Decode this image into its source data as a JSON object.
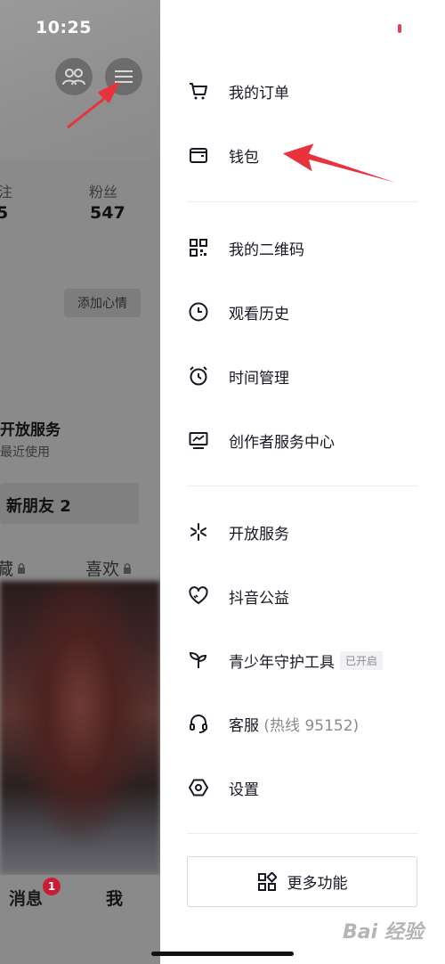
{
  "status_bar": {
    "time": "10:25"
  },
  "profile_bg": {
    "stats": [
      {
        "label": "注",
        "value": "5"
      },
      {
        "label": "粉丝",
        "value": "547"
      }
    ],
    "mood_button": "添加心情",
    "open_service": {
      "title": "开放服务",
      "subtitle": "最近使用"
    },
    "new_friends": "新朋友 2",
    "tabs": [
      {
        "label": "藏"
      },
      {
        "label": "喜欢"
      }
    ],
    "bottom_nav": {
      "messages": "消息",
      "messages_badge": "1",
      "me": "我"
    }
  },
  "drawer": {
    "section1": [
      {
        "label": "我的订单",
        "icon": "cart-icon"
      },
      {
        "label": "钱包",
        "icon": "wallet-icon"
      }
    ],
    "section2": [
      {
        "label": "我的二维码",
        "icon": "qr-code-icon"
      },
      {
        "label": "观看历史",
        "icon": "clock-icon"
      },
      {
        "label": "时间管理",
        "icon": "alarm-icon"
      },
      {
        "label": "创作者服务中心",
        "icon": "chart-monitor-icon"
      }
    ],
    "section3": [
      {
        "label": "开放服务",
        "icon": "sparkle-icon"
      },
      {
        "label": "抖音公益",
        "icon": "heart-icon"
      },
      {
        "label": "青少年守护工具",
        "tag": "已开启",
        "icon": "sprout-icon"
      },
      {
        "label": "客服",
        "sub": " (热线 95152)",
        "icon": "headset-icon"
      },
      {
        "label": "设置",
        "icon": "settings-hex-icon"
      }
    ],
    "more_button": "更多功能"
  },
  "watermark": "Bai 经验",
  "colors": {
    "annotation_arrow": "#e8323c",
    "badge": "#c81e35",
    "text": "#161823"
  }
}
